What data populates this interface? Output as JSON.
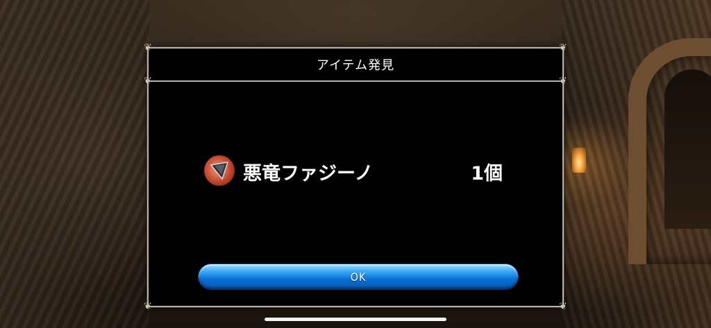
{
  "dialog": {
    "title": "アイテム発見",
    "item": {
      "icon": "dark-dragon-fang-icon",
      "name": "悪竜ファジーノ",
      "count": "1個"
    },
    "ok_label": "OK"
  },
  "colors": {
    "dialog_background": "#000000",
    "frame": "#b9b2a6",
    "button_blue": "#0a6fd6",
    "item_icon_red": "#c0442a"
  }
}
